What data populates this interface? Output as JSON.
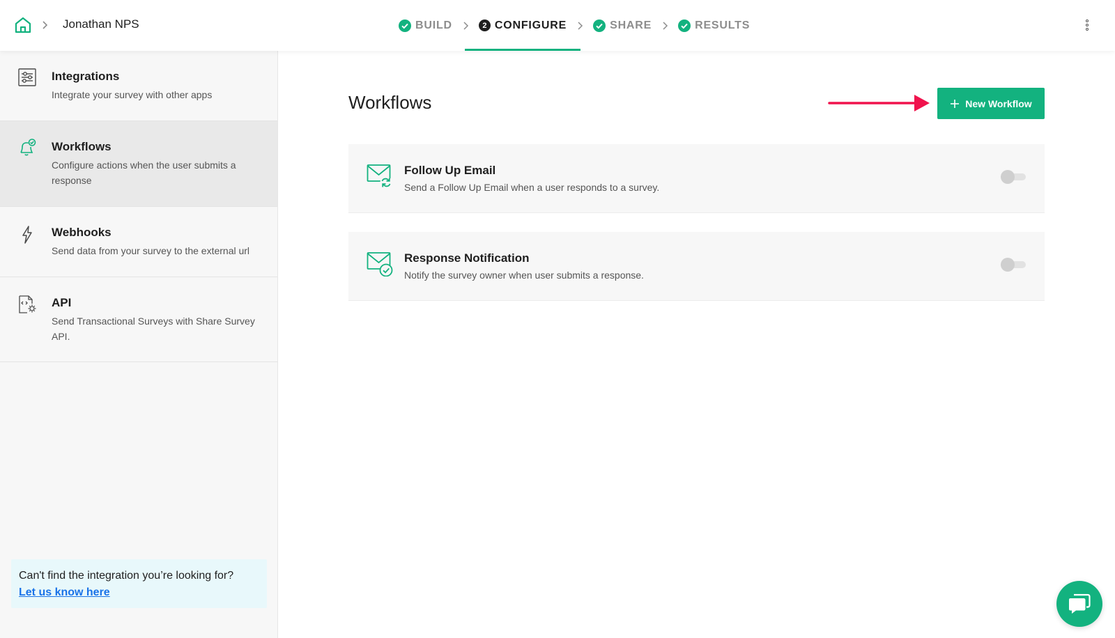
{
  "breadcrumb": {
    "survey_name": "Jonathan NPS"
  },
  "steps": [
    {
      "label": "BUILD",
      "state": "done"
    },
    {
      "label": "CONFIGURE",
      "state": "active",
      "number": "2"
    },
    {
      "label": "SHARE",
      "state": "done"
    },
    {
      "label": "RESULTS",
      "state": "done"
    }
  ],
  "sidebar": {
    "items": [
      {
        "title": "Integrations",
        "description": "Integrate your survey with other apps",
        "icon": "integrations-icon"
      },
      {
        "title": "Workflows",
        "description": "Configure actions when the user submits a response",
        "icon": "bell-check-icon"
      },
      {
        "title": "Webhooks",
        "description": "Send data from your survey to the external url",
        "icon": "lightning-icon"
      },
      {
        "title": "API",
        "description": "Send Transactional Surveys with Share Survey API.",
        "icon": "api-document-icon"
      }
    ],
    "help": {
      "text": "Can't find the integration you’re looking for?",
      "link": "Let us know here"
    }
  },
  "main": {
    "title": "Workflows",
    "new_button_label": "New Workflow",
    "workflows": [
      {
        "title": "Follow Up Email",
        "description": "Send a Follow Up Email when a user responds to a survey.",
        "enabled": false,
        "icon": "mail-refresh-icon"
      },
      {
        "title": "Response Notification",
        "description": "Notify the survey owner when user submits a response.",
        "enabled": false,
        "icon": "mail-check-icon"
      }
    ]
  },
  "colors": {
    "accent": "#13b27f",
    "arrow": "#f0134d",
    "link": "#1a73e8",
    "help_bg": "#e8f8fb"
  }
}
